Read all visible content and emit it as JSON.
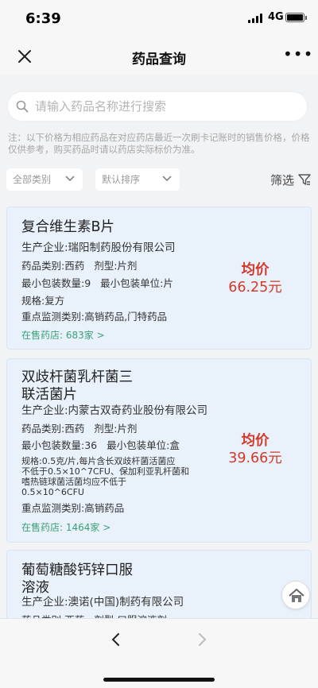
{
  "status": {
    "time": "6:39",
    "network": "4G"
  },
  "nav": {
    "title": "药品查询",
    "more": "•••"
  },
  "search": {
    "placeholder": "请输入药品名称进行搜索"
  },
  "notice": "注：以下价格为相应药品在对应药店最近一次刷卡记账时的销售价格，价格仅供参考，购买药品时请以药店实际标价为准。",
  "filters": {
    "category": "全部类别",
    "sort": "默认排序",
    "filter_label": "筛选"
  },
  "drugs": [
    {
      "name_line1": "复合维生素B片",
      "name_line2": "",
      "manufacturer": "生产企业:瑞阳制药股份有限公司",
      "category": "药品类别:西药",
      "form": "剂型:片剂",
      "min_qty": "最小包装数量:9",
      "min_unit": "最小包装单位:片",
      "spec_lines": [
        "规格:复方"
      ],
      "monitor": "重点监测类别:高销药品,门特药品",
      "stores": "在售药店: 683家 >",
      "price_label": "均价",
      "price": "66.25元"
    },
    {
      "name_line1": "双歧杆菌乳杆菌三",
      "name_line2": "联活菌片",
      "manufacturer": "生产企业:内蒙古双奇药业股份有限公司",
      "category": "药品类别:西药",
      "form": "剂型:片剂",
      "min_qty": "最小包装数量:36",
      "min_unit": "最小包装单位:盒",
      "spec_lines": [
        "规格:0.5克/片,每片含长双歧杆菌活菌应",
        "不低于0.5×10^7CFU、保加利亚乳杆菌和",
        "嗜热链球菌活菌均应不低于",
        "0.5×10^6CFU"
      ],
      "monitor": "重点监测类别:高销药品",
      "stores": "在售药店: 1464家 >",
      "price_label": "均价",
      "price": "39.66元"
    },
    {
      "name_line1": "葡萄糖酸钙锌口服",
      "name_line2": "溶液",
      "manufacturer": "生产企业:澳诺(中国)制药有限公司",
      "category": "药品类别:西药",
      "form": "剂型:口服溶液剂"
    }
  ]
}
